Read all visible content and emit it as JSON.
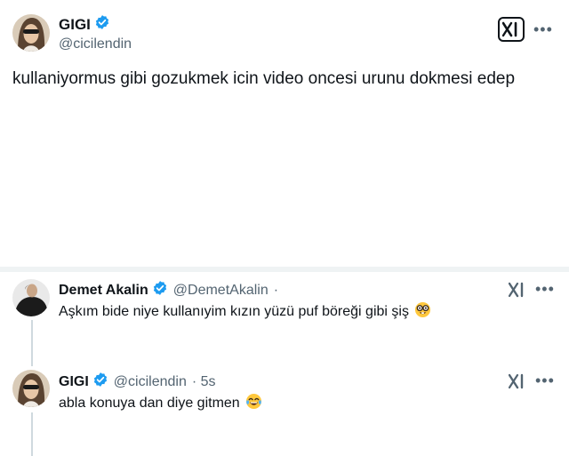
{
  "main_tweet": {
    "display_name": "GIGI",
    "handle": "@cicilendin",
    "text": "kullaniyormus gibi gozukmek icin video oncesi urunu dokmesi edep",
    "more_label": "•••"
  },
  "replies": [
    {
      "display_name": "Demet Akalin",
      "handle": "@DemetAkalin",
      "time": "·",
      "text": "Aşkım bide niye kullanıyim kızın yüzü puf böreği gibi şiş",
      "emoji": "nerd-face",
      "more_label": "•••"
    },
    {
      "display_name": "GIGI",
      "handle": "@cicilendin",
      "time": "· 5s",
      "text": "abla konuya dan diye gitmen",
      "emoji": "tears-of-joy",
      "more_label": "•••"
    }
  ],
  "colors": {
    "verified": "#1d9bf0",
    "text": "#0f1419",
    "secondary": "#536471",
    "separator": "#eff3f4",
    "thread_line": "#cfd9de"
  },
  "icons": [
    "x-logo-icon",
    "verified-badge-icon",
    "more-options-icon",
    "avatar"
  ]
}
